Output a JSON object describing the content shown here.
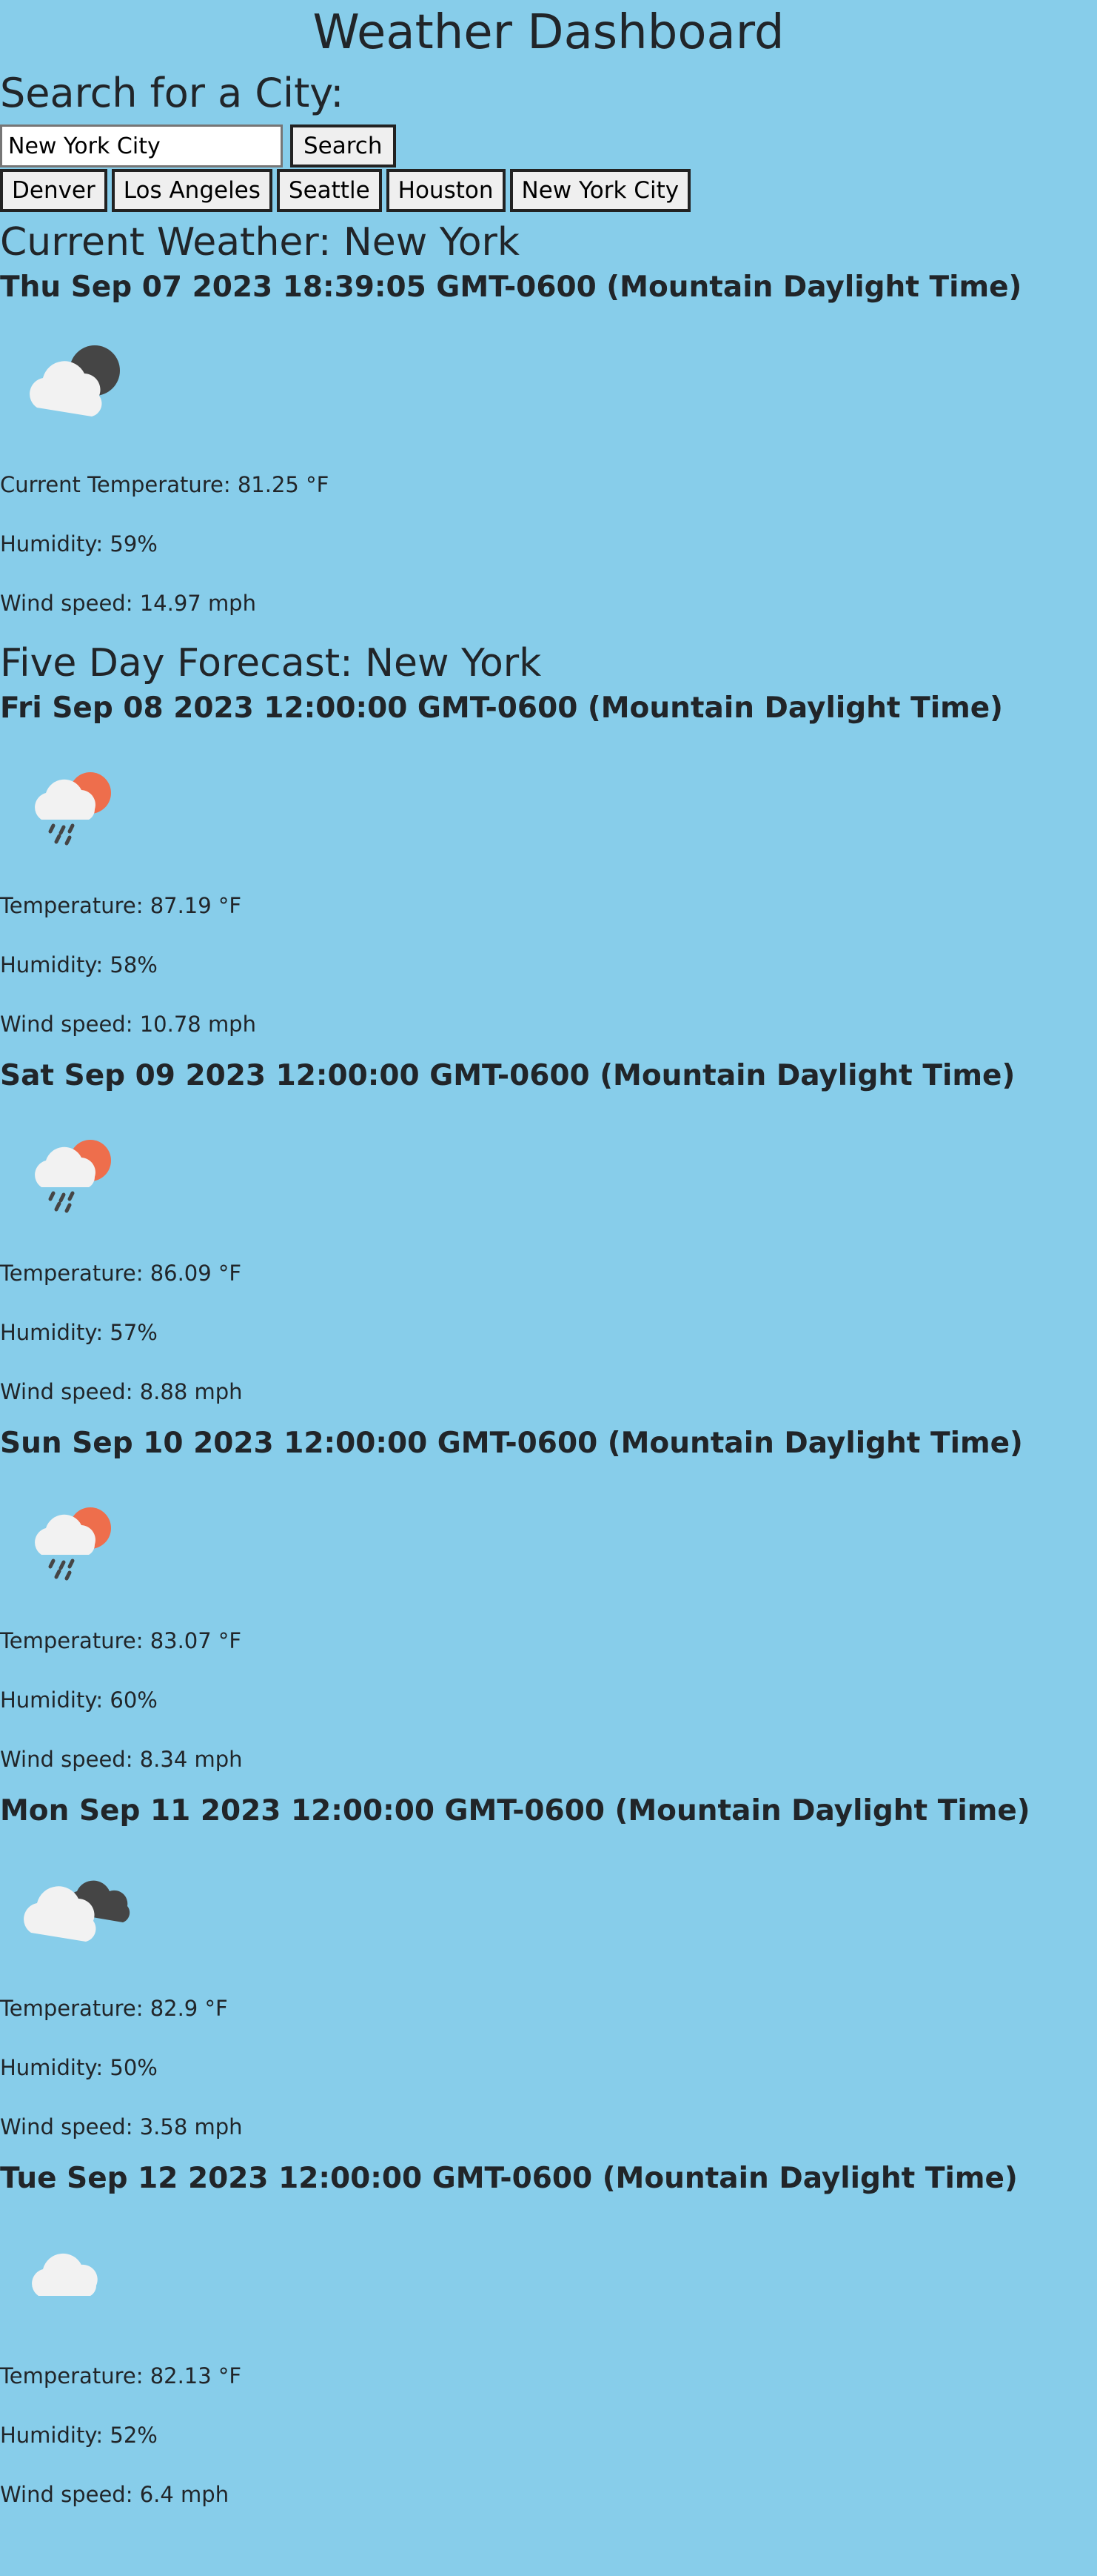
{
  "header": {
    "title": "Weather Dashboard"
  },
  "search": {
    "heading": "Search for a City:",
    "value": "New York City",
    "button_label": "Search"
  },
  "history": [
    "Denver",
    "Los Angeles",
    "Seattle",
    "Houston",
    "New York City"
  ],
  "current": {
    "title": "Current Weather: New York",
    "datetime": "Thu Sep 07 2023 18:39:05 GMT-0600 (Mountain Daylight Time)",
    "icon": "cloud-moon-icon",
    "temperature": "Current Temperature: 81.25 °F",
    "humidity": "Humidity: 59%",
    "wind": "Wind speed: 14.97 mph"
  },
  "forecast": {
    "title": "Five Day Forecast: New York",
    "days": [
      {
        "date": "Fri Sep 08 2023 12:00:00 GMT-0600 (Mountain Daylight Time)",
        "icon": "rain-sun-icon",
        "temperature": "Temperature: 87.19 °F",
        "humidity": "Humidity: 58%",
        "wind": "Wind speed: 10.78 mph"
      },
      {
        "date": "Sat Sep 09 2023 12:00:00 GMT-0600 (Mountain Daylight Time)",
        "icon": "rain-sun-icon",
        "temperature": "Temperature: 86.09 °F",
        "humidity": "Humidity: 57%",
        "wind": "Wind speed: 8.88 mph"
      },
      {
        "date": "Sun Sep 10 2023 12:00:00 GMT-0600 (Mountain Daylight Time)",
        "icon": "rain-sun-icon",
        "temperature": "Temperature: 83.07 °F",
        "humidity": "Humidity: 60%",
        "wind": "Wind speed: 8.34 mph"
      },
      {
        "date": "Mon Sep 11 2023 12:00:00 GMT-0600 (Mountain Daylight Time)",
        "icon": "broken-clouds-icon",
        "temperature": "Temperature: 82.9 °F",
        "humidity": "Humidity: 50%",
        "wind": "Wind speed: 3.58 mph"
      },
      {
        "date": "Tue Sep 12 2023 12:00:00 GMT-0600 (Mountain Daylight Time)",
        "icon": "cloud-icon",
        "temperature": "Temperature: 82.13 °F",
        "humidity": "Humidity: 52%",
        "wind": "Wind speed: 6.4 mph"
      }
    ]
  },
  "colors": {
    "background": "#87cdea",
    "text": "#212529",
    "cloud": "#f2f2f2",
    "dark_cloud": "#454545",
    "sun": "#ee6e4c"
  }
}
